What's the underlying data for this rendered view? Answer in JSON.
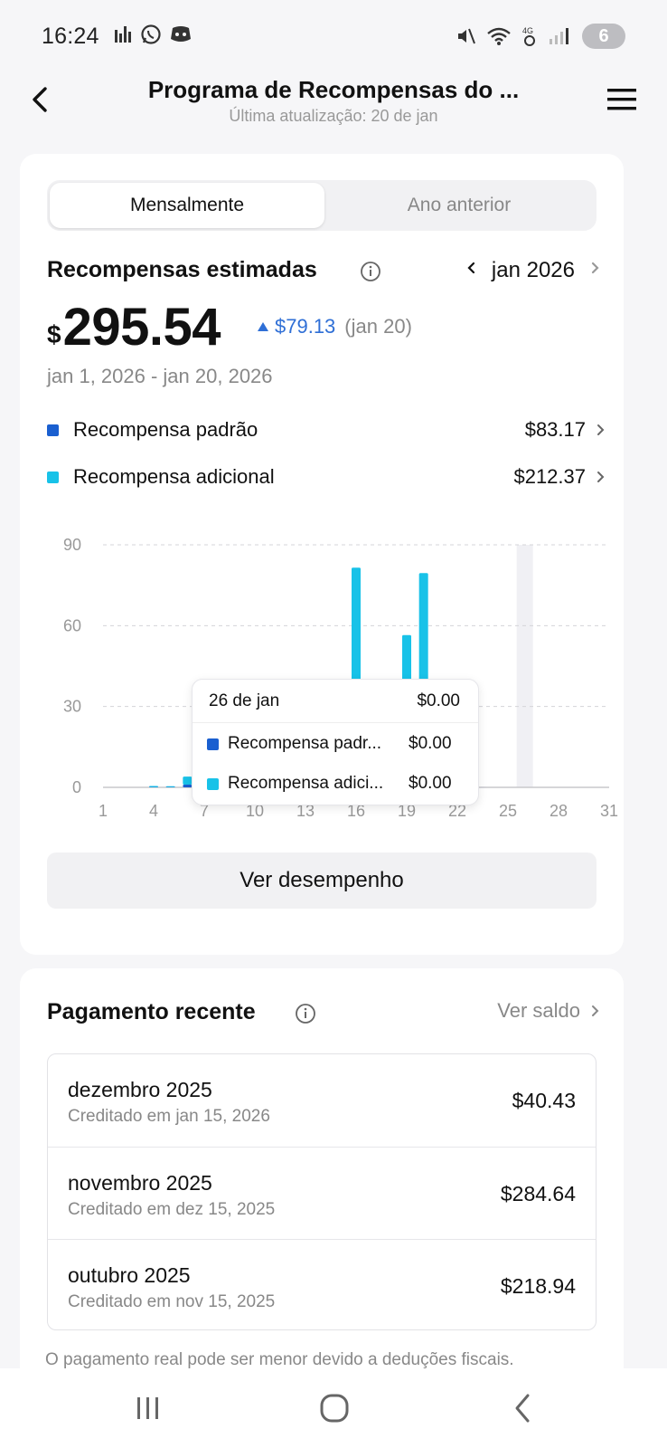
{
  "status": {
    "time": "16:24",
    "battery": "6",
    "network_label": "4G",
    "icons": [
      "bar-chart-icon",
      "whatsapp-icon",
      "discord-icon",
      "mute-icon",
      "wifi-icon",
      "alarm-icon",
      "signal-icon"
    ]
  },
  "header": {
    "title": "Programa de Recompensas do ...",
    "subtitle": "Última atualização: 20 de jan"
  },
  "tabs": {
    "active": "Mensalmente",
    "inactive": "Ano anterior"
  },
  "rewards": {
    "title": "Recompensas estimadas",
    "month": "jan 2026",
    "currency": "$",
    "amount": "295.54",
    "delta": "$79.13",
    "delta_date": "(jan 20)",
    "range": "jan 1, 2026 - jan 20, 2026",
    "legend": [
      {
        "label": "Recompensa padrão",
        "value": "$83.17",
        "color": "#1a5fd0"
      },
      {
        "label": "Recompensa adicional",
        "value": "$212.37",
        "color": "#18c2e8"
      }
    ]
  },
  "chart_data": {
    "type": "bar",
    "stacked": true,
    "x_ticks": [
      "1",
      "4",
      "7",
      "10",
      "13",
      "16",
      "19",
      "22",
      "25",
      "28",
      "31"
    ],
    "y_ticks": [
      "0",
      "30",
      "60",
      "90"
    ],
    "ylim": [
      0,
      90
    ],
    "xlim": [
      1,
      31
    ],
    "grid": true,
    "highlight_day": 26,
    "series": [
      {
        "name": "Recompensa padrão",
        "color": "#1a5fd0",
        "points": [
          [
            4,
            0.1
          ],
          [
            5,
            0.1
          ],
          [
            6,
            1
          ],
          [
            7,
            1.5
          ],
          [
            8,
            1.5
          ],
          [
            9,
            1
          ],
          [
            10,
            0.5
          ],
          [
            11,
            0.5
          ],
          [
            12,
            0.5
          ],
          [
            13,
            0.5
          ],
          [
            14,
            0.5
          ],
          [
            15,
            0.5
          ],
          [
            16,
            0.5
          ],
          [
            17,
            0.5
          ],
          [
            18,
            0.5
          ],
          [
            19,
            0.5
          ],
          [
            20,
            0.5
          ]
        ]
      },
      {
        "name": "Recompensa adicional",
        "color": "#18c2e8",
        "points": [
          [
            4,
            0.4
          ],
          [
            5,
            0.3
          ],
          [
            6,
            3
          ],
          [
            7,
            6
          ],
          [
            8,
            7
          ],
          [
            9,
            6
          ],
          [
            10,
            7
          ],
          [
            11,
            5
          ],
          [
            12,
            4
          ],
          [
            13,
            5
          ],
          [
            14,
            8
          ],
          [
            15,
            10
          ],
          [
            16,
            81
          ],
          [
            17,
            15
          ],
          [
            18,
            10
          ],
          [
            19,
            56
          ],
          [
            20,
            79
          ]
        ]
      }
    ]
  },
  "tooltip": {
    "date": "26 de jan",
    "total": "$0.00",
    "rows": [
      {
        "label": "Recompensa padr...",
        "value": "$0.00",
        "color": "#1a5fd0"
      },
      {
        "label": "Recompensa adici...",
        "value": "$0.00",
        "color": "#18c2e8"
      }
    ]
  },
  "performance_button": "Ver desempenho",
  "payment": {
    "title": "Pagamento recente",
    "view_balance": "Ver saldo",
    "rows": [
      {
        "month": "dezembro 2025",
        "credited": "Creditado em jan 15, 2026",
        "amount": "$40.43"
      },
      {
        "month": "novembro 2025",
        "credited": "Creditado em dez 15, 2025",
        "amount": "$284.64"
      },
      {
        "month": "outubro 2025",
        "credited": "Creditado em nov 15, 2025",
        "amount": "$218.94"
      }
    ],
    "disclaimer": "O pagamento real pode ser menor devido a deduções fiscais."
  }
}
